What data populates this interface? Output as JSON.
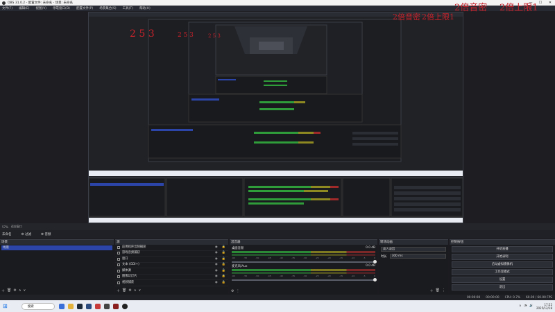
{
  "window": {
    "title": "OBS 31.0.2 - 配置文件: 未命名 - 场景: 未命名"
  },
  "menu": [
    "文件(F)",
    "编辑(E)",
    "视图(V)",
    "停靠窗口(D)",
    "配置文件(P)",
    "场景集合(S)",
    "工具(T)",
    "帮助(H)"
  ],
  "overlay": {
    "nums_a": "2 5 3",
    "nums_b": "2 5 3",
    "nums_c": "2 5 3",
    "top_right_a": "2倍音密",
    "top_right_b": "2倍上限1",
    "small_a": "2倍音密",
    "small_b": "2倍上限1"
  },
  "status_strip": {
    "zoom": "57%",
    "mode": "适应窗口"
  },
  "scene_collection": {
    "label": "未命名",
    "item1": "过滤",
    "item2": "音频"
  },
  "scenes": {
    "header": "场景",
    "items": [
      "场景"
    ]
  },
  "sources": {
    "header": "源",
    "items": [
      {
        "label": "应用程序音频捕获",
        "icon": "speaker-icon"
      },
      {
        "label": "游戏音频捕获",
        "icon": "speaker-icon"
      },
      {
        "label": "窗口",
        "icon": "window-icon"
      },
      {
        "label": "文本 (GDI+)",
        "icon": "text-icon"
      },
      {
        "label": "媒体源",
        "icon": "media-icon"
      },
      {
        "label": "图像幻灯片",
        "icon": "image-icon"
      },
      {
        "label": "视频捕获",
        "icon": "camera-icon"
      }
    ]
  },
  "mixer": {
    "header": "混音器",
    "channels": [
      {
        "name": "桌面音频",
        "db": "0.0 dB"
      },
      {
        "name": "麦克风/Aux",
        "db": "0.0 dB"
      }
    ],
    "ticks": [
      "-60",
      "-55",
      "-50",
      "-45",
      "-40",
      "-35",
      "-30",
      "-25",
      "-20",
      "-15",
      "-10",
      "-5",
      "0"
    ]
  },
  "transitions": {
    "header": "转场动画",
    "selected": "淡入淡出",
    "duration_label": "时长",
    "duration": "300 ms"
  },
  "controls": {
    "header": "控制按钮",
    "buttons": [
      "开始直播",
      "开始录制",
      "启动虚拟摄像机",
      "工作室模式",
      "设置",
      "退出"
    ]
  },
  "app_status": {
    "rec": "00:00:00",
    "live": "00:00:00",
    "cpu": "CPU: 0.7%",
    "fps": "60.00 / 60.00 FPS"
  },
  "taskbar": {
    "search": "搜索",
    "time": "17:22",
    "date": "2025/12/18"
  }
}
